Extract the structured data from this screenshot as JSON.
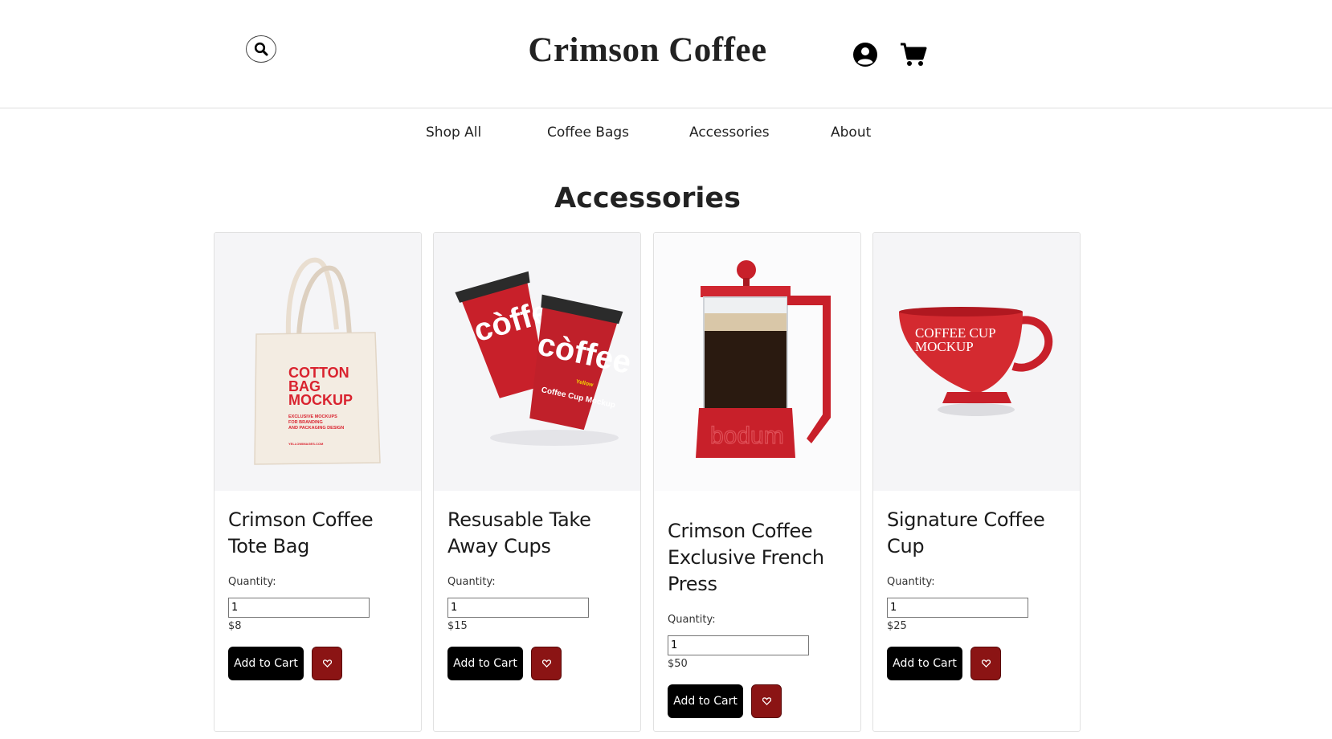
{
  "header": {
    "brand": "Crimson Coffee",
    "icons": {
      "search": "search-icon",
      "account": "user-circle-icon",
      "cart": "shopping-cart-icon"
    }
  },
  "nav": {
    "items": [
      {
        "label": "Shop All"
      },
      {
        "label": "Coffee Bags"
      },
      {
        "label": "Accessories"
      },
      {
        "label": "About"
      }
    ]
  },
  "page": {
    "title": "Accessories"
  },
  "labels": {
    "quantity": "Quantity:",
    "add_to_cart": "Add to Cart",
    "favorite_icon": "heart-icon"
  },
  "colors": {
    "accent": "#8b1414",
    "product_red": "#c8202a",
    "button": "#000000",
    "card_bg": "#f5f5f7"
  },
  "products": [
    {
      "name": "Crimson Coffee Tote Bag",
      "quantity": "1",
      "price": "$8",
      "image": {
        "kind": "tote-bag",
        "lines": [
          "COTTON",
          "BAG",
          "MOCKUP"
        ],
        "small": [
          "EXCLUSIVE MOCKUPS",
          "FOR BRANDING",
          "AND PACKAGING DESIGN"
        ],
        "footer": "YELLOWIMAGES.COM"
      }
    },
    {
      "name": "Resusable Take Away Cups",
      "quantity": "1",
      "price": "$15",
      "image": {
        "kind": "take-away-cups",
        "word": "còffee",
        "small": "Coffee Cup Mockup",
        "tag": "Yellow"
      }
    },
    {
      "name": "Crimson Coffee Exclusive French Press",
      "quantity": "1",
      "price": "$50",
      "image": {
        "kind": "french-press",
        "word": "bodum"
      }
    },
    {
      "name": "Signature Coffee Cup",
      "quantity": "1",
      "price": "$25",
      "image": {
        "kind": "coffee-cup",
        "lines": [
          "COFFEE CUP",
          "MOCKUP"
        ]
      }
    }
  ]
}
